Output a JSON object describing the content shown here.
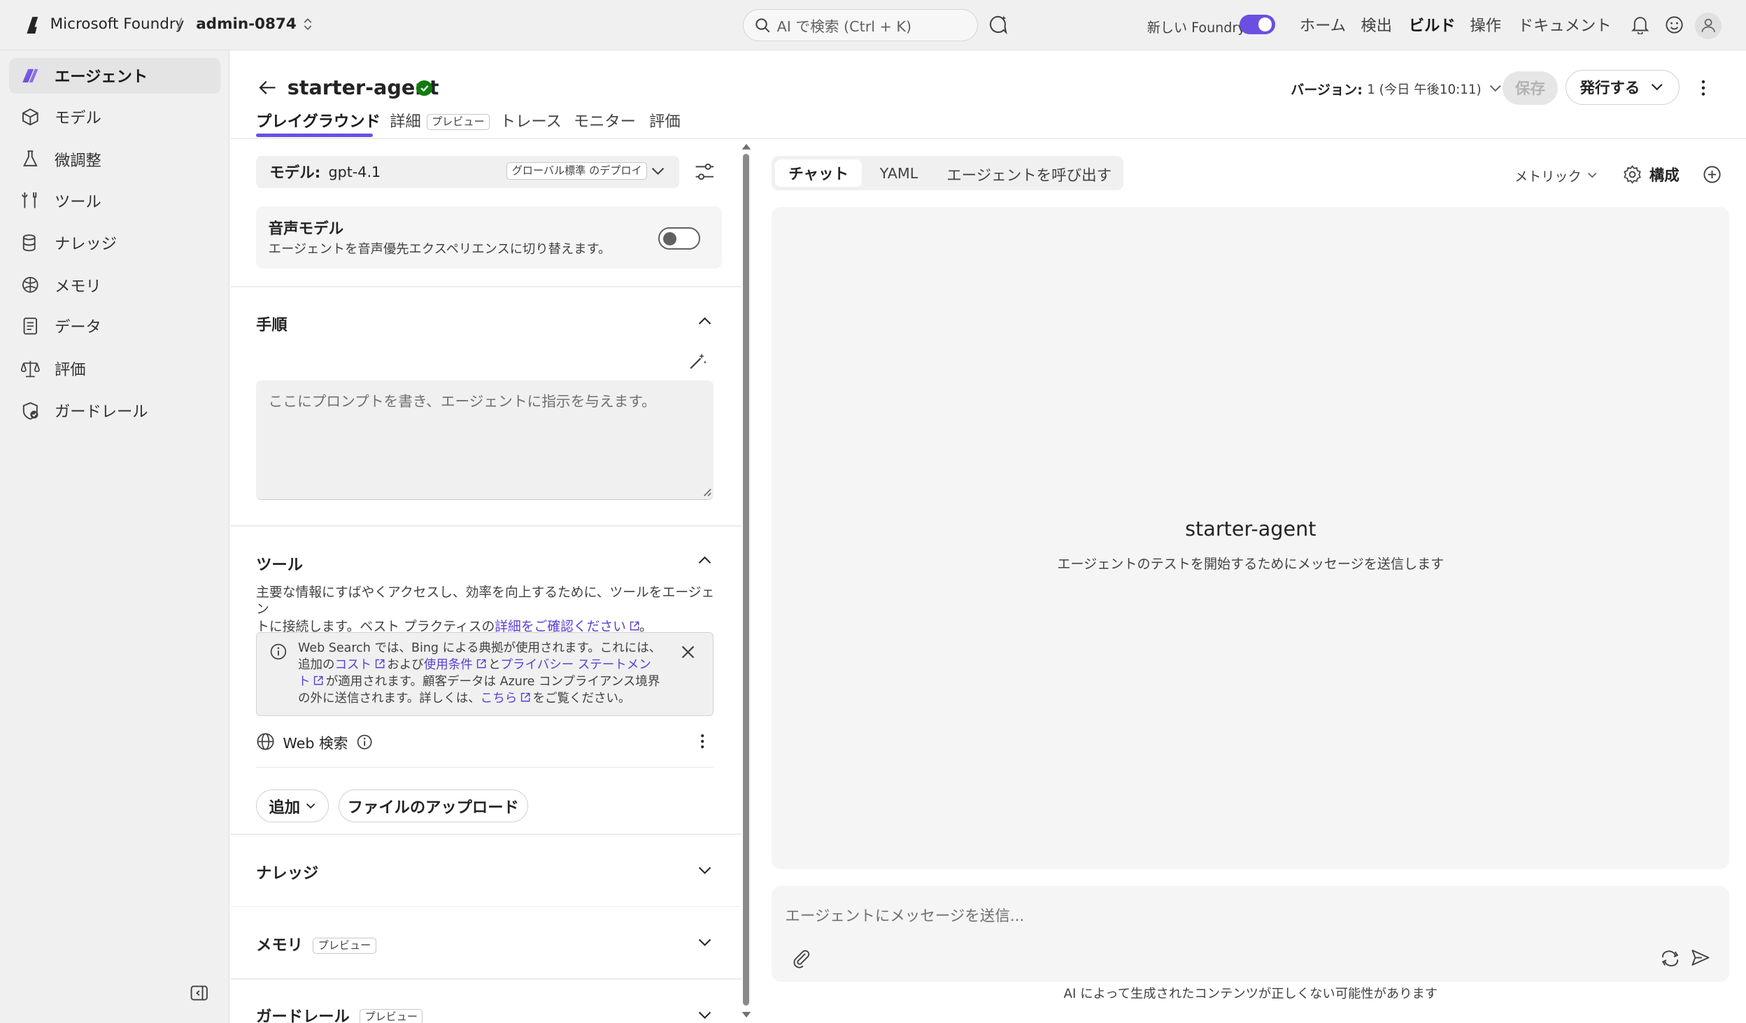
{
  "topbar": {
    "brand": "Microsoft Foundry",
    "separator": "/",
    "project": "admin-0874",
    "search_placeholder": "AI で検索 (Ctrl + K)",
    "new_foundry_label": "新しい Foundry",
    "nav": [
      "ホーム",
      "検出",
      "ビルド",
      "操作",
      "ドキュメント"
    ],
    "active_nav": "ビルド"
  },
  "sidebar": {
    "items": [
      {
        "label": "エージェント",
        "icon": "agent-icon",
        "active": true
      },
      {
        "label": "モデル",
        "icon": "cube-icon"
      },
      {
        "label": "微調整",
        "icon": "flask-icon"
      },
      {
        "label": "ツール",
        "icon": "tools-icon"
      },
      {
        "label": "ナレッジ",
        "icon": "database-icon"
      },
      {
        "label": "メモリ",
        "icon": "brain-icon"
      },
      {
        "label": "データ",
        "icon": "document-icon"
      },
      {
        "label": "評価",
        "icon": "scale-icon"
      },
      {
        "label": "ガードレール",
        "icon": "shield-icon"
      }
    ]
  },
  "header": {
    "agent_name": "starter-agent",
    "version_label": "バージョン:",
    "version_value": "1 (今日 午後10:11)",
    "save_label": "保存",
    "publish_label": "発行する",
    "tabs": [
      {
        "label": "プレイグラウンド",
        "active": true
      },
      {
        "label": "詳細",
        "badge": "プレビュー"
      },
      {
        "label": "トレース"
      },
      {
        "label": "モニター"
      },
      {
        "label": "評価"
      }
    ]
  },
  "config": {
    "model_label": "モデル:",
    "model_value": "gpt-4.1",
    "deployment_badge": "グローバル標準 のデプロイ",
    "voice_title": "音声モデル",
    "voice_desc": "エージェントを音声優先エクスペリエンスに切り替えます。",
    "instructions_title": "手順",
    "instructions_placeholder": "ここにプロンプトを書き、エージェントに指示を与えます。",
    "tools_title": "ツール",
    "tools_desc_1": "主要な情報にすばやくアクセスし、効率を向上するために、ツールをエージェン",
    "tools_desc_2": "トに接続します。ベスト プラクティスの",
    "tools_desc_link": "詳細をご確認ください",
    "tools_desc_end": "。",
    "notice": {
      "line1": "Web Search では、Bing による典拠が使用されます。これには、",
      "line2_a": "追加の",
      "line2_cost": "コスト",
      "line2_b": "および",
      "line2_terms": "使用条件",
      "line2_c": "と",
      "line2_privacy": "プライバシー ステートメン",
      "line3_privacy": "ト",
      "line3_rest": "が適用されます。顧客データは Azure コンプライアンス境界",
      "line4_a": "の外に送信されます。詳しくは、",
      "line4_link": "こちら",
      "line4_b": "をご覧ください。"
    },
    "web_search_label": "Web 検索",
    "add_label": "追加",
    "upload_label": "ファイルのアップロード",
    "knowledge_title": "ナレッジ",
    "memory_title": "メモリ",
    "memory_badge": "プレビュー",
    "guardrail_title": "ガードレール",
    "guardrail_badge": "プレビュー"
  },
  "chat": {
    "tabs": [
      "チャット",
      "YAML",
      "エージェントを呼び出す"
    ],
    "active_tab": "チャット",
    "metrics_label": "メトリック",
    "configure_label": "構成",
    "empty_title": "starter-agent",
    "empty_subtitle": "エージェントのテストを開始するためにメッセージを送信します",
    "input_placeholder": "エージェントにメッセージを送信...",
    "disclaimer": "AI によって生成されたコンテンツが正しくない可能性があります"
  },
  "colors": {
    "accent": "#6b4fe0",
    "link": "#5b3fd1",
    "success": "#107c10"
  }
}
